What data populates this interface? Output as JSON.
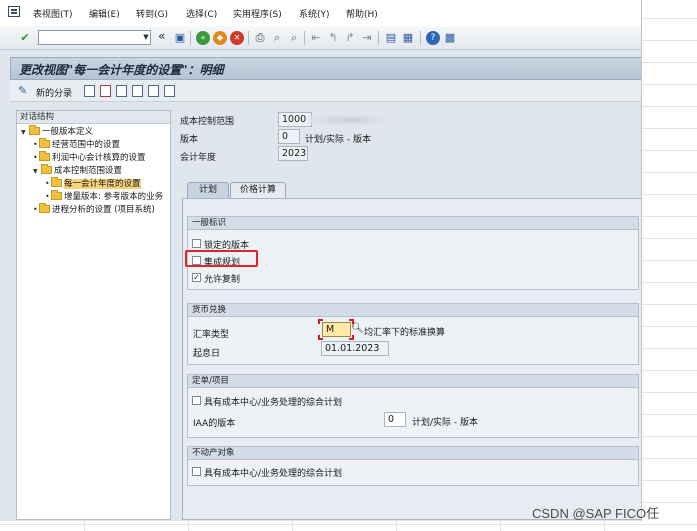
{
  "menu": {
    "items": [
      "表视图(T)",
      "编辑(E)",
      "转到(G)",
      "选择(C)",
      "实用程序(S)",
      "系统(Y)",
      "帮助(H)"
    ]
  },
  "toolbar": {
    "command_value": ""
  },
  "title": "更改视图\"每一会计年度的设置\"：明细",
  "app_toolbar": {
    "new_entries_label": "新的分录"
  },
  "tree": {
    "header": "对话结构",
    "items": [
      {
        "label": "一般版本定义"
      },
      {
        "label": "经营范围中的设置"
      },
      {
        "label": "利润中心会计核算的设置"
      },
      {
        "label": "成本控制范围设置"
      },
      {
        "label": "每一会计年度的设置"
      },
      {
        "label": "增量版本: 参考版本的业务"
      },
      {
        "label": "进程分析的设置 (项目系统)"
      }
    ]
  },
  "header_fields": {
    "controlling_area_label": "成本控制范围",
    "controlling_area_value": "1000",
    "version_label": "版本",
    "version_value": "0",
    "version_desc": "计划/实际 - 版本",
    "fiscal_year_label": "会计年度",
    "fiscal_year_value": "2023"
  },
  "tabs": [
    {
      "label": "计划"
    },
    {
      "label": "价格计算"
    }
  ],
  "groups": {
    "general": {
      "title": "一般标识",
      "locked_version": "锁定的版本",
      "integrated_planning": "集成规划",
      "copy_allowed": "允许复制"
    },
    "currency": {
      "title": "货币兑换",
      "exchange_rate_type_label": "汇率类型",
      "exchange_rate_type_value": "M",
      "exchange_rate_type_desc": "均汇率下的标准换算",
      "value_date_label": "起息日",
      "value_date_value": "01.01.2023"
    },
    "orders": {
      "title": "定单/项目",
      "integrated_cc_planning": "具有成本中心/业务处理的综合计划",
      "iaa_version_label": "IAA的版本",
      "iaa_version_value": "0",
      "iaa_version_desc": "计划/实际 - 版本"
    },
    "real_estate": {
      "title": "不动产对象",
      "integrated_cc_planning": "具有成本中心/业务处理的综合计划"
    }
  },
  "watermark": "CSDN @SAP FICO任",
  "colors": {
    "highlight": "#e0252a",
    "folder": "#f0c040",
    "selected_row": "#f7d27a"
  }
}
